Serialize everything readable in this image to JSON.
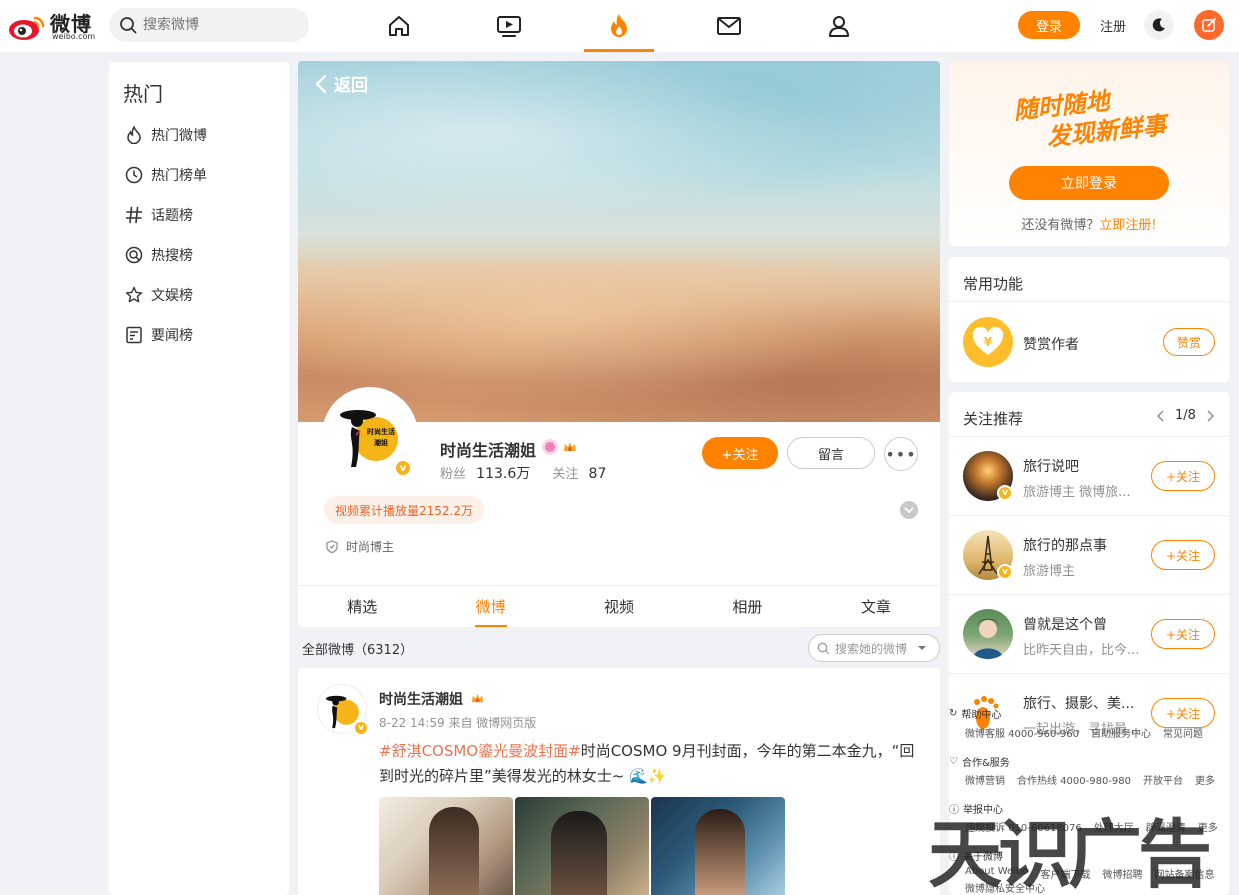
{
  "header": {
    "logo_text": "微博",
    "logo_sub": "weibo.com",
    "search_placeholder": "搜索微博",
    "nav": [
      "home-icon",
      "video-icon",
      "hot-icon",
      "mail-icon",
      "user-icon"
    ],
    "active_nav": "hot-icon",
    "login_label": "登录",
    "register_label": "注册",
    "accent_color": "#ff8200"
  },
  "sidebar": {
    "title": "热门",
    "items": [
      {
        "label": "热门微博",
        "icon": "flame-icon"
      },
      {
        "label": "热门榜单",
        "icon": "clock-icon"
      },
      {
        "label": "话题榜",
        "icon": "hashtag-icon"
      },
      {
        "label": "热搜榜",
        "icon": "search-circle-icon"
      },
      {
        "label": "文娱榜",
        "icon": "star-icon"
      },
      {
        "label": "要闻榜",
        "icon": "news-icon"
      }
    ]
  },
  "profile": {
    "back_label": "返回",
    "avatar_text": "时尚生活潮姐",
    "name": "时尚生活潮姐",
    "fans_label": "粉丝",
    "fans_value": "113.6万",
    "follow_label": "关注",
    "follow_value": "87",
    "follow_button": "+关注",
    "message_button": "留言",
    "more_button": "•••",
    "play_tag": "视频累计播放量2152.2万",
    "role": "时尚博主",
    "tabs": [
      "精选",
      "微博",
      "视频",
      "相册",
      "文章"
    ],
    "active_tab": "微博"
  },
  "feed": {
    "all_label": "全部微博（6312）",
    "search_placeholder": "搜索她的微博"
  },
  "post": {
    "author": "时尚生活潮姐",
    "meta": "8-22 14:59 来自 微博网页版",
    "tag": "#舒淇COSMO鎏光曼波封面#",
    "text": "时尚COSMO 9月刊封面，今年的第二本金九，“回到时光的碎片里”美得发光的林女士~ ",
    "emoji": "🌊✨"
  },
  "promo": {
    "slogan_line1": "随时随地",
    "slogan_line2": "发现新鲜事",
    "button": "立即登录",
    "tip": "还没有微博？",
    "tip_link": "立即注册!"
  },
  "functions": {
    "title": "常用功能",
    "item_label": "赞赏作者",
    "item_button": "赞赏"
  },
  "recommend": {
    "title": "关注推荐",
    "pager": "1/8",
    "follow_label": "+关注",
    "items": [
      {
        "name": "旅行说吧",
        "desc": "旅游博主 微博旅..."
      },
      {
        "name": "旅行的那点事",
        "desc": "旅游博主"
      },
      {
        "name": "曾就是这个曾",
        "desc": "比昨天自由，比今..."
      },
      {
        "name": "旅行、摄影、美...",
        "desc": "一起出游，寻找最..."
      }
    ]
  },
  "footer": {
    "help": {
      "title": "帮助中心",
      "row": [
        "微博客服 4000-960-960",
        "自助服务中心",
        "常见问题"
      ]
    },
    "biz": {
      "title": "合作&服务",
      "row": [
        "微博营销",
        "合作热线 4000-980-980",
        "开放平台",
        "更多"
      ]
    },
    "report": {
      "title": "举报中心",
      "row": [
        "违规投诉 010-60618076",
        "处理大厅",
        "辟谣澄清",
        "更多"
      ]
    },
    "about": {
      "title": "关于微博",
      "row": [
        "About Weibo",
        "客户端下载",
        "微博招聘",
        "网站备案信息"
      ],
      "row2": "微博隐私安全中心"
    }
  },
  "watermark": "天识广告"
}
